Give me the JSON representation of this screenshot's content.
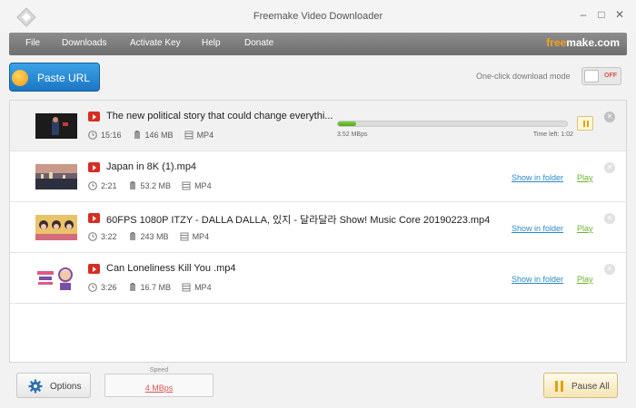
{
  "window": {
    "title": "Freemake Video Downloader",
    "controls": [
      "–",
      "□",
      "✕"
    ]
  },
  "menu": {
    "items": [
      "File",
      "Downloads",
      "Activate Key",
      "Help",
      "Donate"
    ],
    "brand_part1": "free",
    "brand_part2": "make.com"
  },
  "toolbar": {
    "paste_url_label": "Paste URL",
    "one_click_label": "One-click download mode",
    "toggle_state": "OFF"
  },
  "downloads": [
    {
      "title": "The new political story that could change everythi...",
      "duration": "15:16",
      "size": "146 MB",
      "format": "MP4",
      "progress": 0.08,
      "rate": "3.52   MBps",
      "time_left": "Time left: 1:02",
      "thumb_colors": [
        "#1b1b1b",
        "#c43b3b",
        "#2d3e63"
      ]
    },
    {
      "title": "Japan in 8K (1).mp4",
      "duration": "2:21",
      "size": "53.2 MB",
      "format": "MP4",
      "show_in_folder": "Show in folder",
      "play": "Play",
      "thumb_colors": [
        "#6d5f6e",
        "#c79a8a",
        "#2c2f3e"
      ]
    },
    {
      "title": "60FPS 1080P   ITZY - DALLA DALLA, 있지 - 달라달라 Show! Music Core 20190223.mp4",
      "duration": "3:22",
      "size": "243 MB",
      "format": "MP4",
      "show_in_folder": "Show in folder",
      "play": "Play",
      "thumb_colors": [
        "#e8c36a",
        "#d46b7a",
        "#3d2c2c"
      ]
    },
    {
      "title": "Can Loneliness Kill You .mp4",
      "duration": "3:26",
      "size": "16.7 MB",
      "format": "MP4",
      "show_in_folder": "Show in folder",
      "play": "Play",
      "thumb_colors": [
        "#ffffff",
        "#e0568a",
        "#7a4fa6"
      ]
    }
  ],
  "footer": {
    "options_label": "Options",
    "speed_caption": "Speed",
    "speed_value": "4   MBps",
    "pause_all_label": "Pause All"
  },
  "colors": {
    "accent_blue": "#1d76c4",
    "link_blue": "#2a88c8",
    "play_green": "#6bb22b",
    "progress_green": "#52a51e",
    "speed_red": "#d9534f",
    "brand_orange": "#f4a31c"
  }
}
